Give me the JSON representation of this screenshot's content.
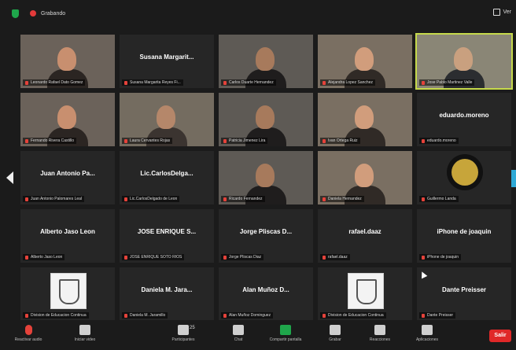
{
  "window": {
    "recording_label": "Grabando",
    "view_label": "Ver"
  },
  "tiles": [
    {
      "id": "t1",
      "kind": "video",
      "center_name": "",
      "tag": "Leonardo Rafael Dato Gomez"
    },
    {
      "id": "t2",
      "kind": "name",
      "center_name": "Susana Margarit...",
      "tag": "Susana Margarita Reyes Fi..."
    },
    {
      "id": "t3",
      "kind": "video",
      "center_name": "",
      "tag": "Carlos Duarte Hernandez"
    },
    {
      "id": "t4",
      "kind": "video",
      "center_name": "",
      "tag": "Alejandra Lopez Sanchez"
    },
    {
      "id": "t5",
      "kind": "video",
      "center_name": "",
      "tag": "Jose Pablo Martinez Valle",
      "active": true
    },
    {
      "id": "t6",
      "kind": "video",
      "center_name": "",
      "tag": "Fernando Rivera Castillo"
    },
    {
      "id": "t7",
      "kind": "video",
      "center_name": "",
      "tag": "Laura Cervantes Rojas"
    },
    {
      "id": "t8",
      "kind": "video",
      "center_name": "",
      "tag": "Patricia Jimenez Lira"
    },
    {
      "id": "t9",
      "kind": "video",
      "center_name": "",
      "tag": "Ivan Ortega Ruiz"
    },
    {
      "id": "t10",
      "kind": "name",
      "center_name": "eduardo.moreno",
      "tag": "eduardo.moreno"
    },
    {
      "id": "t11",
      "kind": "name",
      "center_name": "Juan Antonio Pa...",
      "tag": "Juan Antonio Palomares Leal"
    },
    {
      "id": "t12",
      "kind": "name",
      "center_name": "Lic.CarlosDelga...",
      "tag": "Lic.CarlosDelgado de Leon"
    },
    {
      "id": "t13",
      "kind": "video",
      "center_name": "",
      "tag": "Ricardo Fernandez"
    },
    {
      "id": "t14",
      "kind": "video",
      "center_name": "",
      "tag": "Daniela Hernandez"
    },
    {
      "id": "t15",
      "kind": "badge",
      "center_name": "",
      "tag": "Guillermo Landa"
    },
    {
      "id": "t16",
      "kind": "name",
      "center_name": "Alberto Jaso Leon",
      "tag": "Alberto Jaso Leon"
    },
    {
      "id": "t17",
      "kind": "name",
      "center_name": "JOSE ENRIQUE S...",
      "tag": "JOSE ENRIQUE SOTO RIOS"
    },
    {
      "id": "t18",
      "kind": "name",
      "center_name": "Jorge Pliscas D...",
      "tag": "Jorge Pliscas Diaz"
    },
    {
      "id": "t19",
      "kind": "name",
      "center_name": "rafael.daaz",
      "tag": "rafael.daaz"
    },
    {
      "id": "t20",
      "kind": "name",
      "center_name": "iPhone de joaquin",
      "tag": "iPhone de joaquin"
    },
    {
      "id": "t21",
      "kind": "logo",
      "center_name": "",
      "tag": "Division de Educacion Continua"
    },
    {
      "id": "t22",
      "kind": "name",
      "center_name": "Daniela M. Jara...",
      "tag": "Daniela M. Jaramillo"
    },
    {
      "id": "t23",
      "kind": "name",
      "center_name": "Alan Muñoz D...",
      "tag": "Alan Muñoz Dominguez"
    },
    {
      "id": "t24",
      "kind": "logo",
      "center_name": "",
      "tag": "Division de Educacion Continua"
    },
    {
      "id": "t25",
      "kind": "name",
      "center_name": "Dante Preisser",
      "tag": "Dante Preisser"
    }
  ],
  "toolbar": {
    "items": [
      {
        "name": "unmute-button",
        "label": "Reactivar audio",
        "cls": "mic"
      },
      {
        "name": "stop-video-button",
        "label": "Iniciar video",
        "cls": ""
      },
      {
        "name": "participants-button",
        "label": "Participantes",
        "cls": ""
      },
      {
        "name": "chat-button",
        "label": "Chat",
        "cls": ""
      },
      {
        "name": "share-screen-button",
        "label": "Compartir pantalla",
        "cls": "share"
      },
      {
        "name": "record-button",
        "label": "Grabar",
        "cls": ""
      },
      {
        "name": "reactions-button",
        "label": "Reacciones",
        "cls": ""
      },
      {
        "name": "apps-button",
        "label": "Aplicaciones",
        "cls": ""
      }
    ],
    "participants_count": "25",
    "end_label": "Salir"
  },
  "colors": {
    "accent": "#c6d94b",
    "mute": "#e5423a",
    "share": "#1fa64b",
    "end": "#e02828"
  }
}
